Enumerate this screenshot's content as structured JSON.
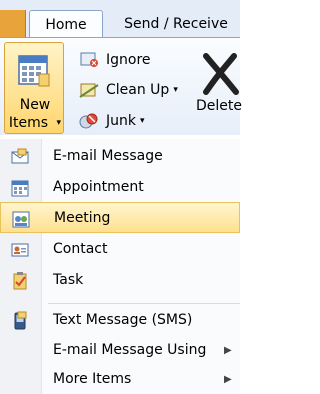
{
  "tabs": {
    "home": "Home",
    "send_receive": "Send / Receive"
  },
  "ribbon": {
    "new_items": {
      "line1": "New",
      "line2": "Items",
      "caret": "▾"
    },
    "ignore": "Ignore",
    "clean_up": "Clean Up",
    "junk": "Junk",
    "delete": "Delete",
    "caret": "▾"
  },
  "menu": {
    "items": [
      {
        "label": "E-mail Message",
        "icon": "email-message-icon"
      },
      {
        "label": "Appointment",
        "icon": "appointment-calendar-icon"
      },
      {
        "label": "Meeting",
        "icon": "meeting-icon",
        "highlighted": true
      },
      {
        "label": "Contact",
        "icon": "contact-card-icon"
      },
      {
        "label": "Task",
        "icon": "task-clipboard-icon"
      },
      {
        "label": "Text Message (SMS)",
        "icon": "sms-phone-icon"
      },
      {
        "label": "E-mail Message Using",
        "submenu": true
      },
      {
        "label": "More Items",
        "submenu": true
      }
    ],
    "submenu_arrow": "▶"
  },
  "colors": {
    "ribbon_bg": "#e4ecf7",
    "highlight": "#ffe08f",
    "file_tab": "#e8a33a"
  }
}
